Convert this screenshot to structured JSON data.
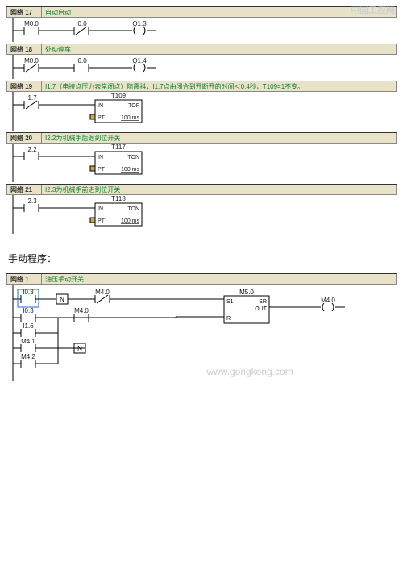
{
  "watermark_top": "中国工控网",
  "watermark_center": "www.gongkong.com",
  "section2_title": "手动程序：",
  "networks": [
    {
      "num": "17",
      "title": "自动启动",
      "contacts": [
        {
          "label": "M0.0",
          "neg": false
        },
        {
          "label": "I0.0",
          "neg": true
        }
      ],
      "coil": "Q1.3",
      "timer": null
    },
    {
      "num": "18",
      "title": "处动停车",
      "contacts": [
        {
          "label": "M0.0",
          "neg": true
        },
        {
          "label": "I0.0",
          "neg": false
        }
      ],
      "coil": "Q1.4",
      "timer": null
    },
    {
      "num": "19",
      "title": "I1.7（电接点压力表常闭点）防震抖；I1.7点由闭合到开断开的时间＜0.4秒，T109=1不变。",
      "contacts": [
        {
          "label": "I1.7",
          "neg": true
        }
      ],
      "coil": null,
      "timer": {
        "name": "T109",
        "type": "TOF",
        "pt": "100 ms"
      }
    },
    {
      "num": "20",
      "title": "I2.2为机械手后退到位开关",
      "contacts": [
        {
          "label": "I2.2",
          "neg": false
        }
      ],
      "coil": null,
      "timer": {
        "name": "T117",
        "type": "TON",
        "pt": "100 ms"
      }
    },
    {
      "num": "21",
      "title": "I2.3为机械手前进到位开关",
      "contacts": [
        {
          "label": "I2.3",
          "neg": false
        }
      ],
      "coil": null,
      "timer": {
        "name": "T118",
        "type": "TON",
        "pt": "100 ms"
      }
    }
  ],
  "manual_network": {
    "num": "1",
    "title": "油压手动开关",
    "sr_block": {
      "name": "M5.0",
      "type": "SR",
      "out": "M4.0"
    },
    "top_row": [
      {
        "label": "I0.3",
        "neg": false,
        "edge": true
      },
      {
        "label": "N",
        "neg": false,
        "edge_box": true
      },
      {
        "label": "M4.0",
        "neg": true
      }
    ],
    "rows": [
      [
        {
          "label": "I0.3",
          "neg": false
        },
        {
          "label": "M4.0",
          "neg": false
        }
      ],
      [
        {
          "label": "I1.6",
          "neg": false
        }
      ],
      [
        {
          "label": "M4.1",
          "neg": false
        },
        {
          "label": "N",
          "edge_box": true
        }
      ],
      [
        {
          "label": "M4.2",
          "neg": false
        }
      ]
    ]
  }
}
